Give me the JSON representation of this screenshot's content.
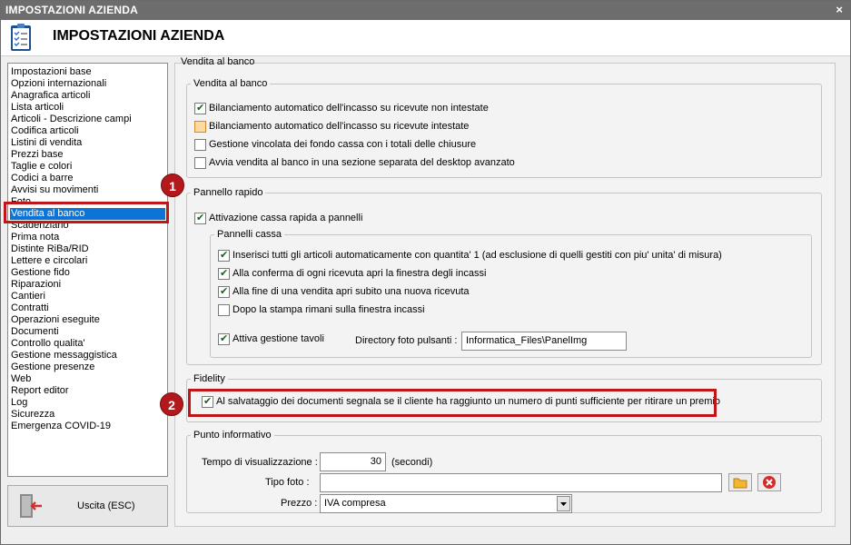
{
  "window": {
    "title": "IMPOSTAZIONI AZIENDA",
    "close_glyph": "×"
  },
  "header": {
    "title": "IMPOSTAZIONI AZIENDA",
    "icon": "clipboard-checklist-icon"
  },
  "sidebar": {
    "items": [
      "Impostazioni base",
      "Opzioni internazionali",
      "Anagrafica articoli",
      "Lista articoli",
      "Articoli - Descrizione campi",
      "Codifica articoli",
      "Listini di vendita",
      "Prezzi base",
      "Taglie e colori",
      "Codici a barre",
      "Avvisi su movimenti",
      "Foto",
      "Vendita al banco",
      "Scadenziario",
      "Prima nota",
      "Distinte RiBa/RID",
      "Lettere e circolari",
      "Gestione fido",
      "Riparazioni",
      "Cantieri",
      "Contratti",
      "Operazioni eseguite",
      "Documenti",
      "Controllo qualita'",
      "Gestione messaggistica",
      "Gestione presenze",
      "Web",
      "Report editor",
      "Log",
      "Sicurezza",
      "Emergenza COVID-19"
    ],
    "selected_index": 12
  },
  "exit_button": {
    "label": "Uscita (ESC)",
    "icon": "exit-door-icon"
  },
  "main": {
    "outer_group": "Vendita al banco",
    "vendita": {
      "title": "Vendita al banco",
      "options": [
        {
          "label": "Bilanciamento automatico dell'incasso su ricevute non intestate",
          "checked": true
        },
        {
          "label": "Bilanciamento automatico dell'incasso su ricevute intestate",
          "checked": false
        },
        {
          "label": "Gestione vincolata dei fondo cassa con i totali delle chiusure",
          "checked": false
        },
        {
          "label": "Avvia vendita al banco in una sezione separata del desktop avanzato",
          "checked": false
        }
      ]
    },
    "pannello": {
      "title": "Pannello rapido",
      "attivazione": {
        "label": "Attivazione cassa rapida a pannelli",
        "checked": true
      },
      "pannelli_cassa": {
        "title": "Pannelli cassa",
        "options": [
          {
            "label": "Inserisci tutti gli articoli automaticamente con quantita' 1 (ad esclusione di quelli gestiti con piu' unita' di misura)",
            "checked": true
          },
          {
            "label": "Alla conferma di ogni ricevuta apri la finestra degli incassi",
            "checked": true
          },
          {
            "label": "Alla fine di una vendita apri subito una nuova ricevuta",
            "checked": true
          },
          {
            "label": "Dopo la stampa rimani sulla finestra incassi",
            "checked": false
          }
        ],
        "gestione_tavoli": {
          "label": "Attiva gestione tavoli",
          "checked": true
        },
        "directory_label": "Directory foto pulsanti :",
        "directory_value": "Informatica_Files\\PanelImg"
      }
    },
    "fidelity": {
      "title": "Fidelity",
      "option": {
        "label": "Al salvataggio dei documenti segnala se il cliente ha raggiunto un numero di punti sufficiente per ritirare un premio",
        "checked": true
      }
    },
    "punto": {
      "title": "Punto informativo",
      "tempo_label": "Tempo di visualizzazione :",
      "tempo_value": "30",
      "tempo_unit": "(secondi)",
      "tipo_foto_label": "Tipo foto :",
      "tipo_foto_value": "",
      "prezzo_label": "Prezzo :",
      "prezzo_value": "IVA compresa"
    }
  },
  "annotations": {
    "badge1": "1",
    "badge2": "2",
    "color": "#c0161a"
  }
}
